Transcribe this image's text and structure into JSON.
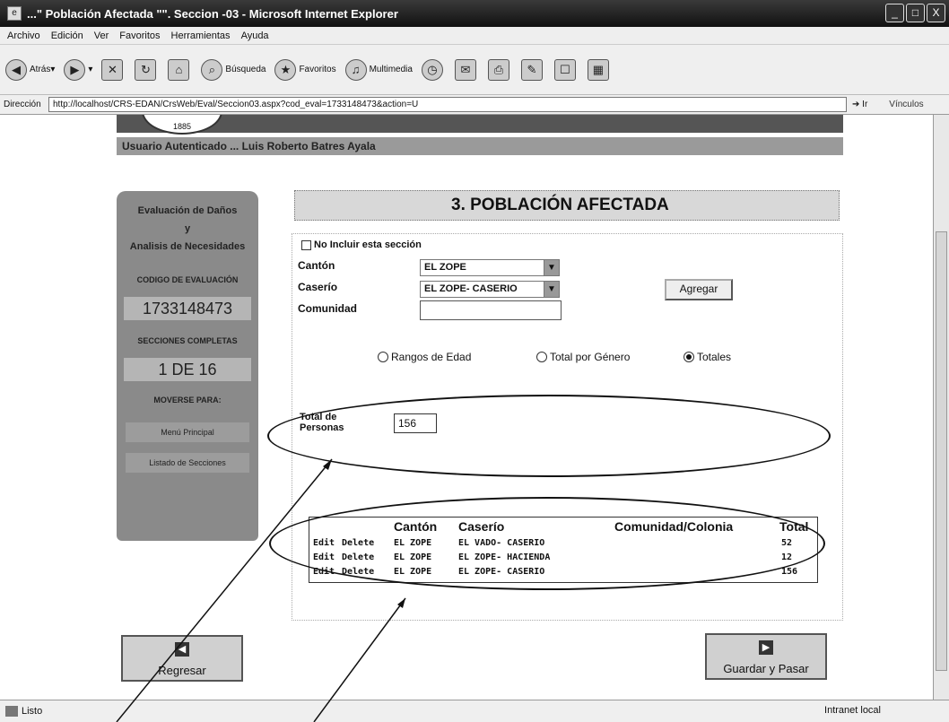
{
  "window": {
    "title": "...\" Población Afectada \"\". Seccion -03 - Microsoft Internet Explorer",
    "controls": [
      "_",
      "□",
      "X"
    ]
  },
  "menu": [
    "Archivo",
    "Edición",
    "Ver",
    "Favoritos",
    "Herramientas",
    "Ayuda"
  ],
  "toolbar": {
    "back": "Atrás",
    "search": "Búsqueda",
    "favorites": "Favoritos",
    "multimedia": "Multimedia"
  },
  "address": {
    "label": "Dirección",
    "url": "http://localhost/CRS-EDAN/CrsWeb/Eval/Seccion03.aspx?cod_eval=1733148473&action=U",
    "go": "Ir",
    "links": "Vínculos"
  },
  "page": {
    "logo_year": "1885",
    "user": "Usuario Autenticado ... Luis Roberto Batres Ayala",
    "sidebar": {
      "title_line1": "Evaluación de Daños",
      "title_line2": "y",
      "title_line3": "Analisis de Necesidades",
      "code_label": "CODIGO DE EVALUACIÓN",
      "code_value": "1733148473",
      "sections_label": "SECCIONES COMPLETAS",
      "sections_value": "1 DE 16",
      "nav_label": "MOVERSE PARA:",
      "nav_item1": "Menú Principal",
      "nav_item2": "Listado de Secciones"
    },
    "section_title": "3. POBLACIÓN AFECTADA",
    "form": {
      "exclude_label": "No Incluir esta sección",
      "canton_label": "Cantón",
      "canton_value": "EL ZOPE",
      "caserio_label": "Caserío",
      "caserio_value": "EL ZOPE- CASERIO",
      "comunidad_label": "Comunidad",
      "comunidad_value": "",
      "add_button": "Agregar",
      "radio_options": [
        "Rangos de Edad",
        "Total por Género",
        "Totales"
      ],
      "radio_selected": "Totales",
      "total_label_line1": "Total de",
      "total_label_line2": "Personas",
      "total_value": "156"
    },
    "grid": {
      "headers": [
        "Cantón",
        "Caserío",
        "Comunidad/Colonia",
        "Total"
      ],
      "rows": [
        {
          "edit": "Edit",
          "delete": "Delete",
          "canton": "EL ZOPE",
          "caserio": "EL VADO- CASERIO",
          "comunidad": "",
          "total": "52"
        },
        {
          "edit": "Edit",
          "delete": "Delete",
          "canton": "EL ZOPE",
          "caserio": "EL ZOPE- HACIENDA",
          "comunidad": "",
          "total": "12"
        },
        {
          "edit": "Edit",
          "delete": "Delete",
          "canton": "EL ZOPE",
          "caserio": "EL ZOPE- CASERIO",
          "comunidad": "",
          "total": "156"
        }
      ]
    },
    "back_button": "Regresar",
    "save_button": "Guardar y Pasar"
  },
  "status": {
    "text": "Listo",
    "zone": "Intranet local"
  }
}
